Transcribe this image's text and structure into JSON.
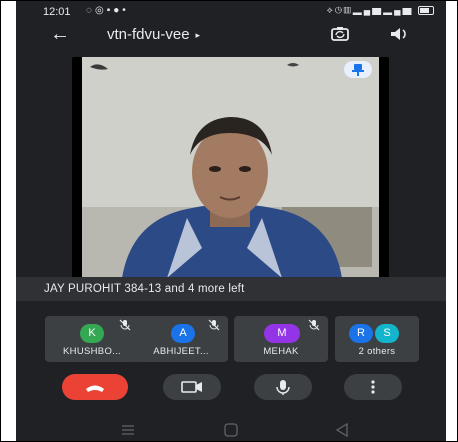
{
  "status_bar": {
    "time": "12:01",
    "left_icons": [
      "circle-notification-icon",
      "whatsapp-icon",
      "message-icon",
      "chat-icon",
      "dot-icon"
    ],
    "right_icons": [
      "vibrate-icon",
      "alarm-icon",
      "volte-icon",
      "signal-icon",
      "signal-icon",
      "battery-icon"
    ]
  },
  "app_bar": {
    "title": "vtn-fdvu-vee",
    "title_caret": "▸",
    "back_icon": "arrow-back-icon",
    "flip_camera_icon": "switch-camera-icon",
    "speaker_icon": "volume-icon"
  },
  "main_video": {
    "pin_icon": "pin-icon"
  },
  "caption": {
    "text": "JAY PUROHIT 384-13 and 4 more left"
  },
  "participants": [
    {
      "initial": "K",
      "name": "KHUSHBO...",
      "avatar_color": "#34a853",
      "muted": true
    },
    {
      "initial": "A",
      "name": "ABHIJEET...",
      "avatar_color": "#1a73e8",
      "muted": true
    },
    {
      "initial": "M",
      "name": "MEHAK",
      "avatar_color": "#9334e6",
      "muted": true
    },
    {
      "initial": "R",
      "initial2": "S",
      "name": "2 others",
      "avatar_color": "#1a73e8",
      "avatar_color2": "#12b5cb",
      "muted": false
    }
  ],
  "controls": {
    "end_call_icon": "phone-hangup-icon",
    "camera_icon": "videocam-icon",
    "mic_icon": "mic-icon",
    "more_icon": "more-vert-icon"
  },
  "nav_bar": {
    "icons": [
      "menu-icon",
      "home-square-icon",
      "back-triangle-icon"
    ]
  },
  "colors": {
    "background": "#202124",
    "tile": "#3c4043",
    "end_call": "#ea4335",
    "pin_chip": "#e8f0fe"
  }
}
